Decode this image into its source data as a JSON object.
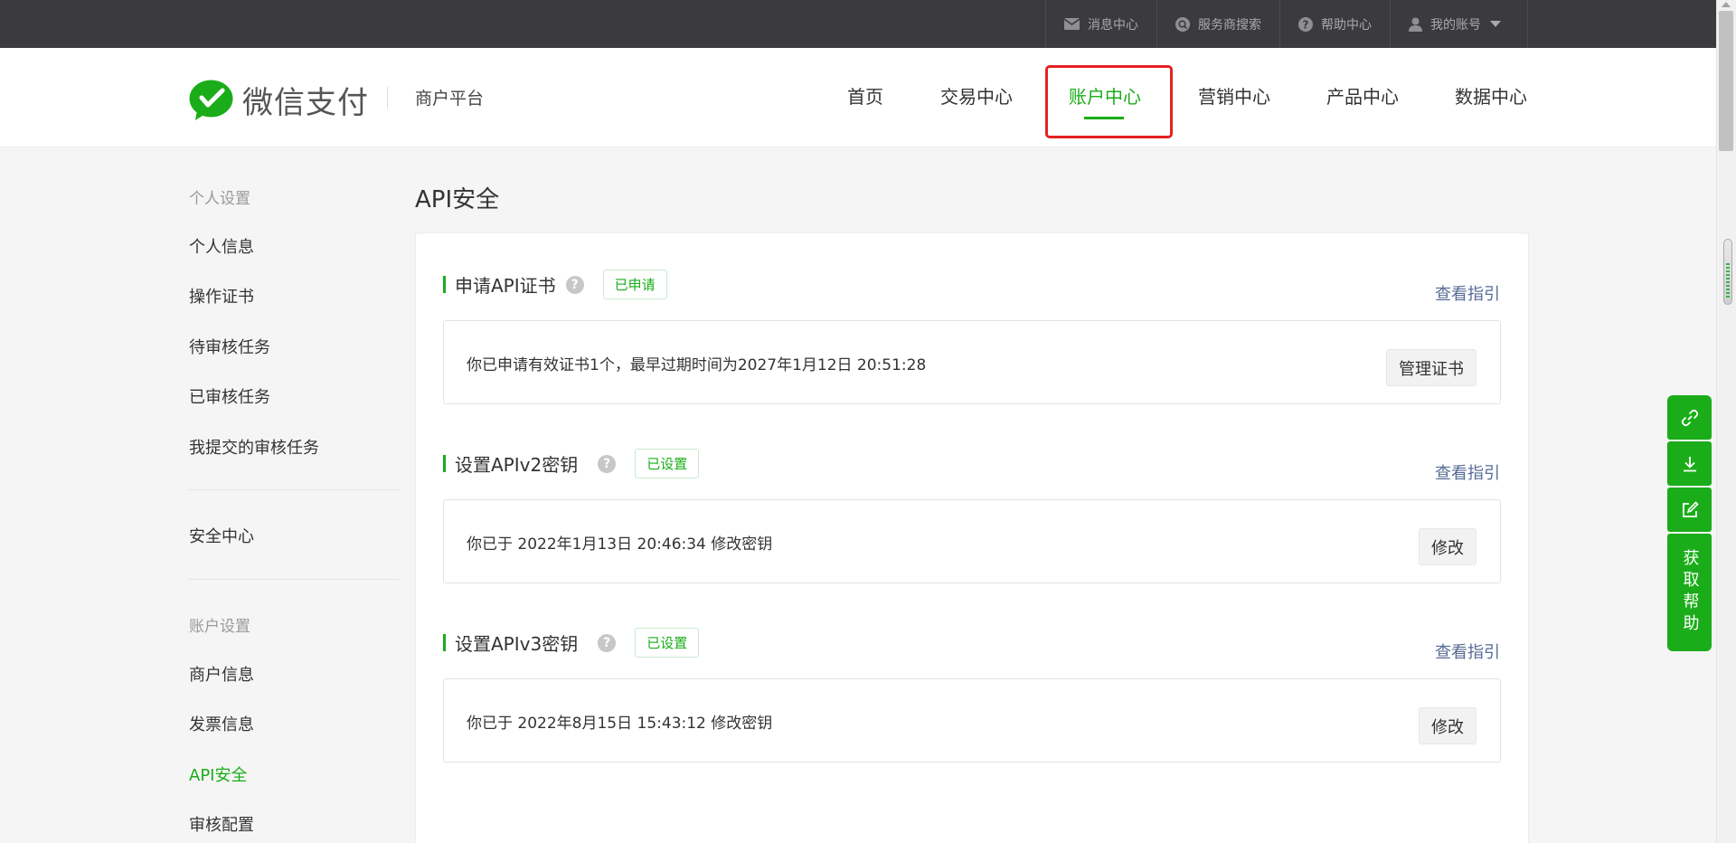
{
  "topbar": {
    "links": [
      {
        "label": "消息中心",
        "icon": "mail-icon"
      },
      {
        "label": "服务商搜索",
        "icon": "search-icon"
      },
      {
        "label": "帮助中心",
        "icon": "question-icon"
      },
      {
        "label": "我的账号",
        "icon": "user-icon"
      }
    ]
  },
  "header": {
    "logo_text": "微信支付",
    "platform": "商户平台",
    "nav": [
      "首页",
      "交易中心",
      "账户中心",
      "营销中心",
      "产品中心",
      "数据中心"
    ],
    "active_nav": "账户中心"
  },
  "sidebar": {
    "group1": "个人设置",
    "group1_items": [
      "个人信息",
      "操作证书",
      "待审核任务",
      "已审核任务",
      "我提交的审核任务"
    ],
    "security": "安全中心",
    "group2": "账户设置",
    "group2_items": [
      "商户信息",
      "发票信息",
      "API安全",
      "审核配置"
    ],
    "active": "API安全"
  },
  "main": {
    "title": "API安全",
    "sections": [
      {
        "title": "申请API证书",
        "badge": "已申请",
        "guide": "查看指引",
        "info": "你已申请有效证书1个，最早过期时间为2027年1月12日 20:51:28",
        "button": "管理证书"
      },
      {
        "title": "设置APIv2密钥",
        "badge": "已设置",
        "guide": "查看指引",
        "info": "你已于 2022年1月13日 20:46:34 修改密钥",
        "button": "修改"
      },
      {
        "title": "设置APIv3密钥",
        "badge": "已设置",
        "guide": "查看指引",
        "info": "你已于 2022年8月15日 15:43:12 修改密钥",
        "button": "修改"
      }
    ]
  },
  "float_toolbar": {
    "icons": [
      "link-icon",
      "download-icon",
      "edit-icon"
    ],
    "help_label": "获取帮助"
  },
  "colors": {
    "brand_green": "#1aad19",
    "topbar": "#3b3b3d",
    "link_blue": "#576b95",
    "highlight_red": "#e52121"
  }
}
